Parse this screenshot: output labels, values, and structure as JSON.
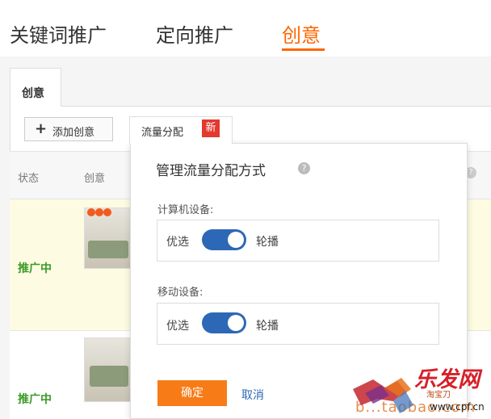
{
  "top_tabs": [
    {
      "label": "关键词推广",
      "active": false
    },
    {
      "label": "定向推广",
      "active": false
    },
    {
      "label": "创意",
      "active": true
    }
  ],
  "sub_tab": "创意",
  "toolbar": {
    "add_icon": "plus-icon",
    "add_label": "添加创意",
    "traffic_label": "流量分配",
    "new_badge": "新"
  },
  "table": {
    "headers": [
      "状态",
      "创意"
    ],
    "rows": [
      {
        "status": "推广中"
      },
      {
        "status": "推广中"
      }
    ]
  },
  "popup": {
    "title": "管理流量分配方式",
    "help_icon": "question-circle-icon",
    "sections": [
      {
        "label": "计算机设备:",
        "left_option": "优选",
        "right_option": "轮播",
        "toggle_on": true
      },
      {
        "label": "移动设备:",
        "left_option": "优选",
        "right_option": "轮播",
        "toggle_on": true
      }
    ],
    "confirm_label": "确定",
    "cancel_label": "取消"
  },
  "watermark": {
    "url_text": "b...taobao.com",
    "brand": "乐发网",
    "sub": "淘宝刀",
    "site": "www.cpf.cn"
  },
  "colors": {
    "accent": "#ff6600",
    "toggle": "#2d68b6",
    "status": "#3a9a26",
    "badge": "#e3392e"
  }
}
